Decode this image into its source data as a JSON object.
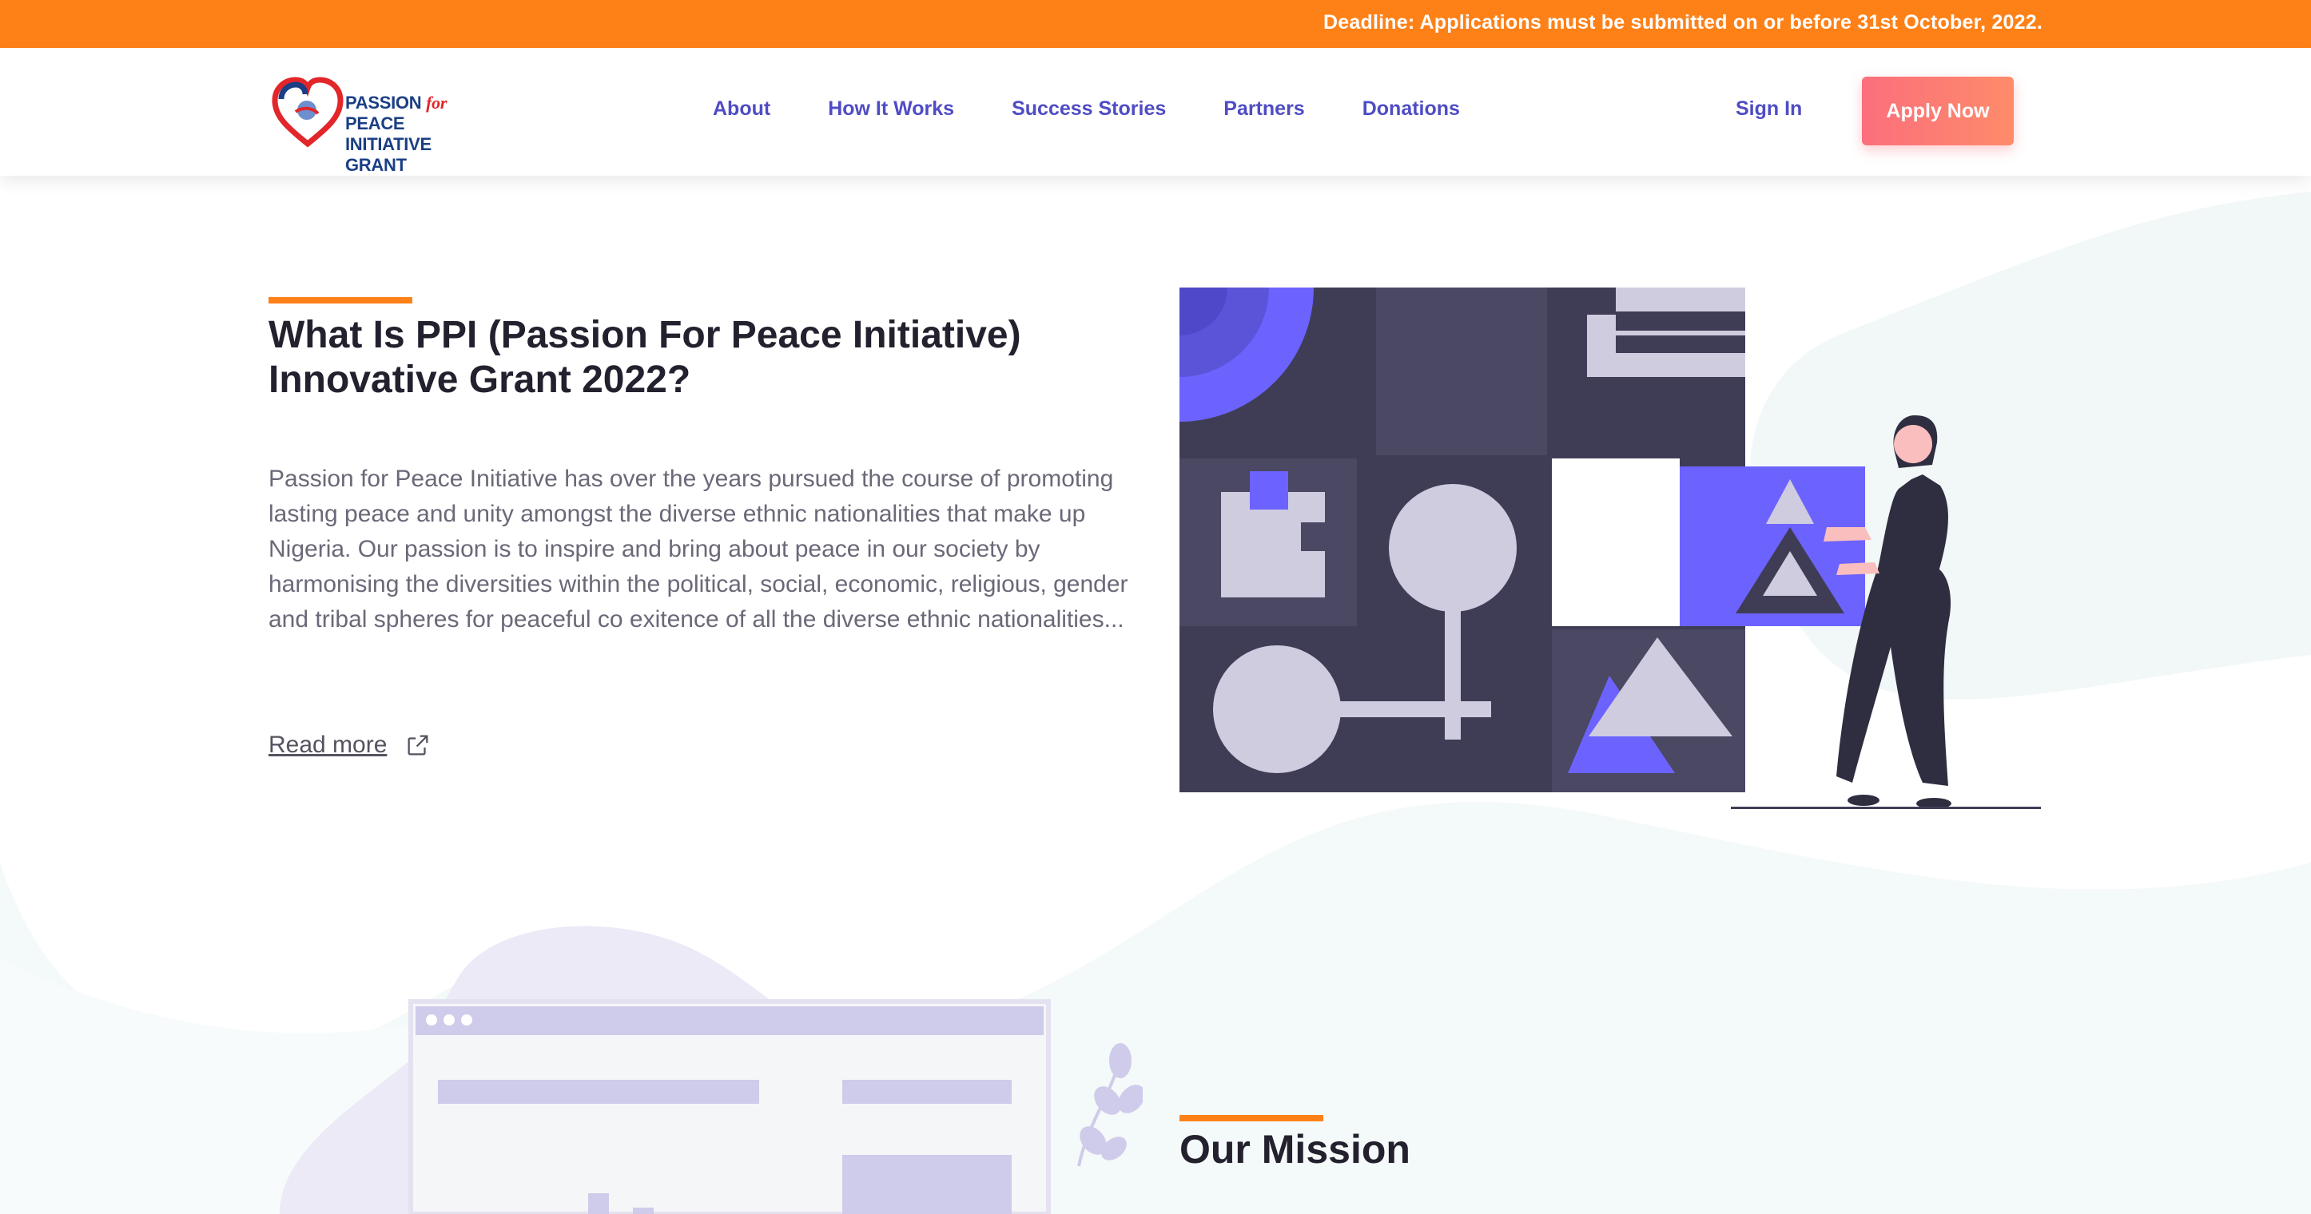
{
  "banner": {
    "text": "Deadline: Applications must be submitted on or before 31st October, 2022."
  },
  "logo": {
    "line1_a": "PASSION",
    "line1_for": "for",
    "line1_b": "PEACE",
    "line2": "INITIATIVE GRANT"
  },
  "nav": {
    "items": [
      "About",
      "How It Works",
      "Success Stories",
      "Partners",
      "Donations"
    ],
    "signin": "Sign In",
    "apply": "Apply Now"
  },
  "intro": {
    "title": "What Is PPI (Passion For Peace Initiative) Innovative Grant 2022?",
    "paragraph": "Passion for Peace Initiative has over the years pursued the course of promoting lasting peace and unity amongst the diverse ethnic nationalities that make up Nigeria. Our passion is to inspire and bring about peace in our society by harmonising the diversities within the political, social, economic, religious, gender and tribal spheres for peaceful co exitence of all the diverse ethnic nationalities...",
    "read_more": "Read more"
  },
  "mission": {
    "title": "Our Mission"
  },
  "colors": {
    "accent_orange": "#fe8118",
    "nav_purple": "#4f4cc4",
    "apply_gradient_start": "#fb6f7c",
    "apply_gradient_end": "#fe8b6a",
    "illustration_dark": "#3f3d56",
    "illustration_purple": "#6c63ff"
  }
}
